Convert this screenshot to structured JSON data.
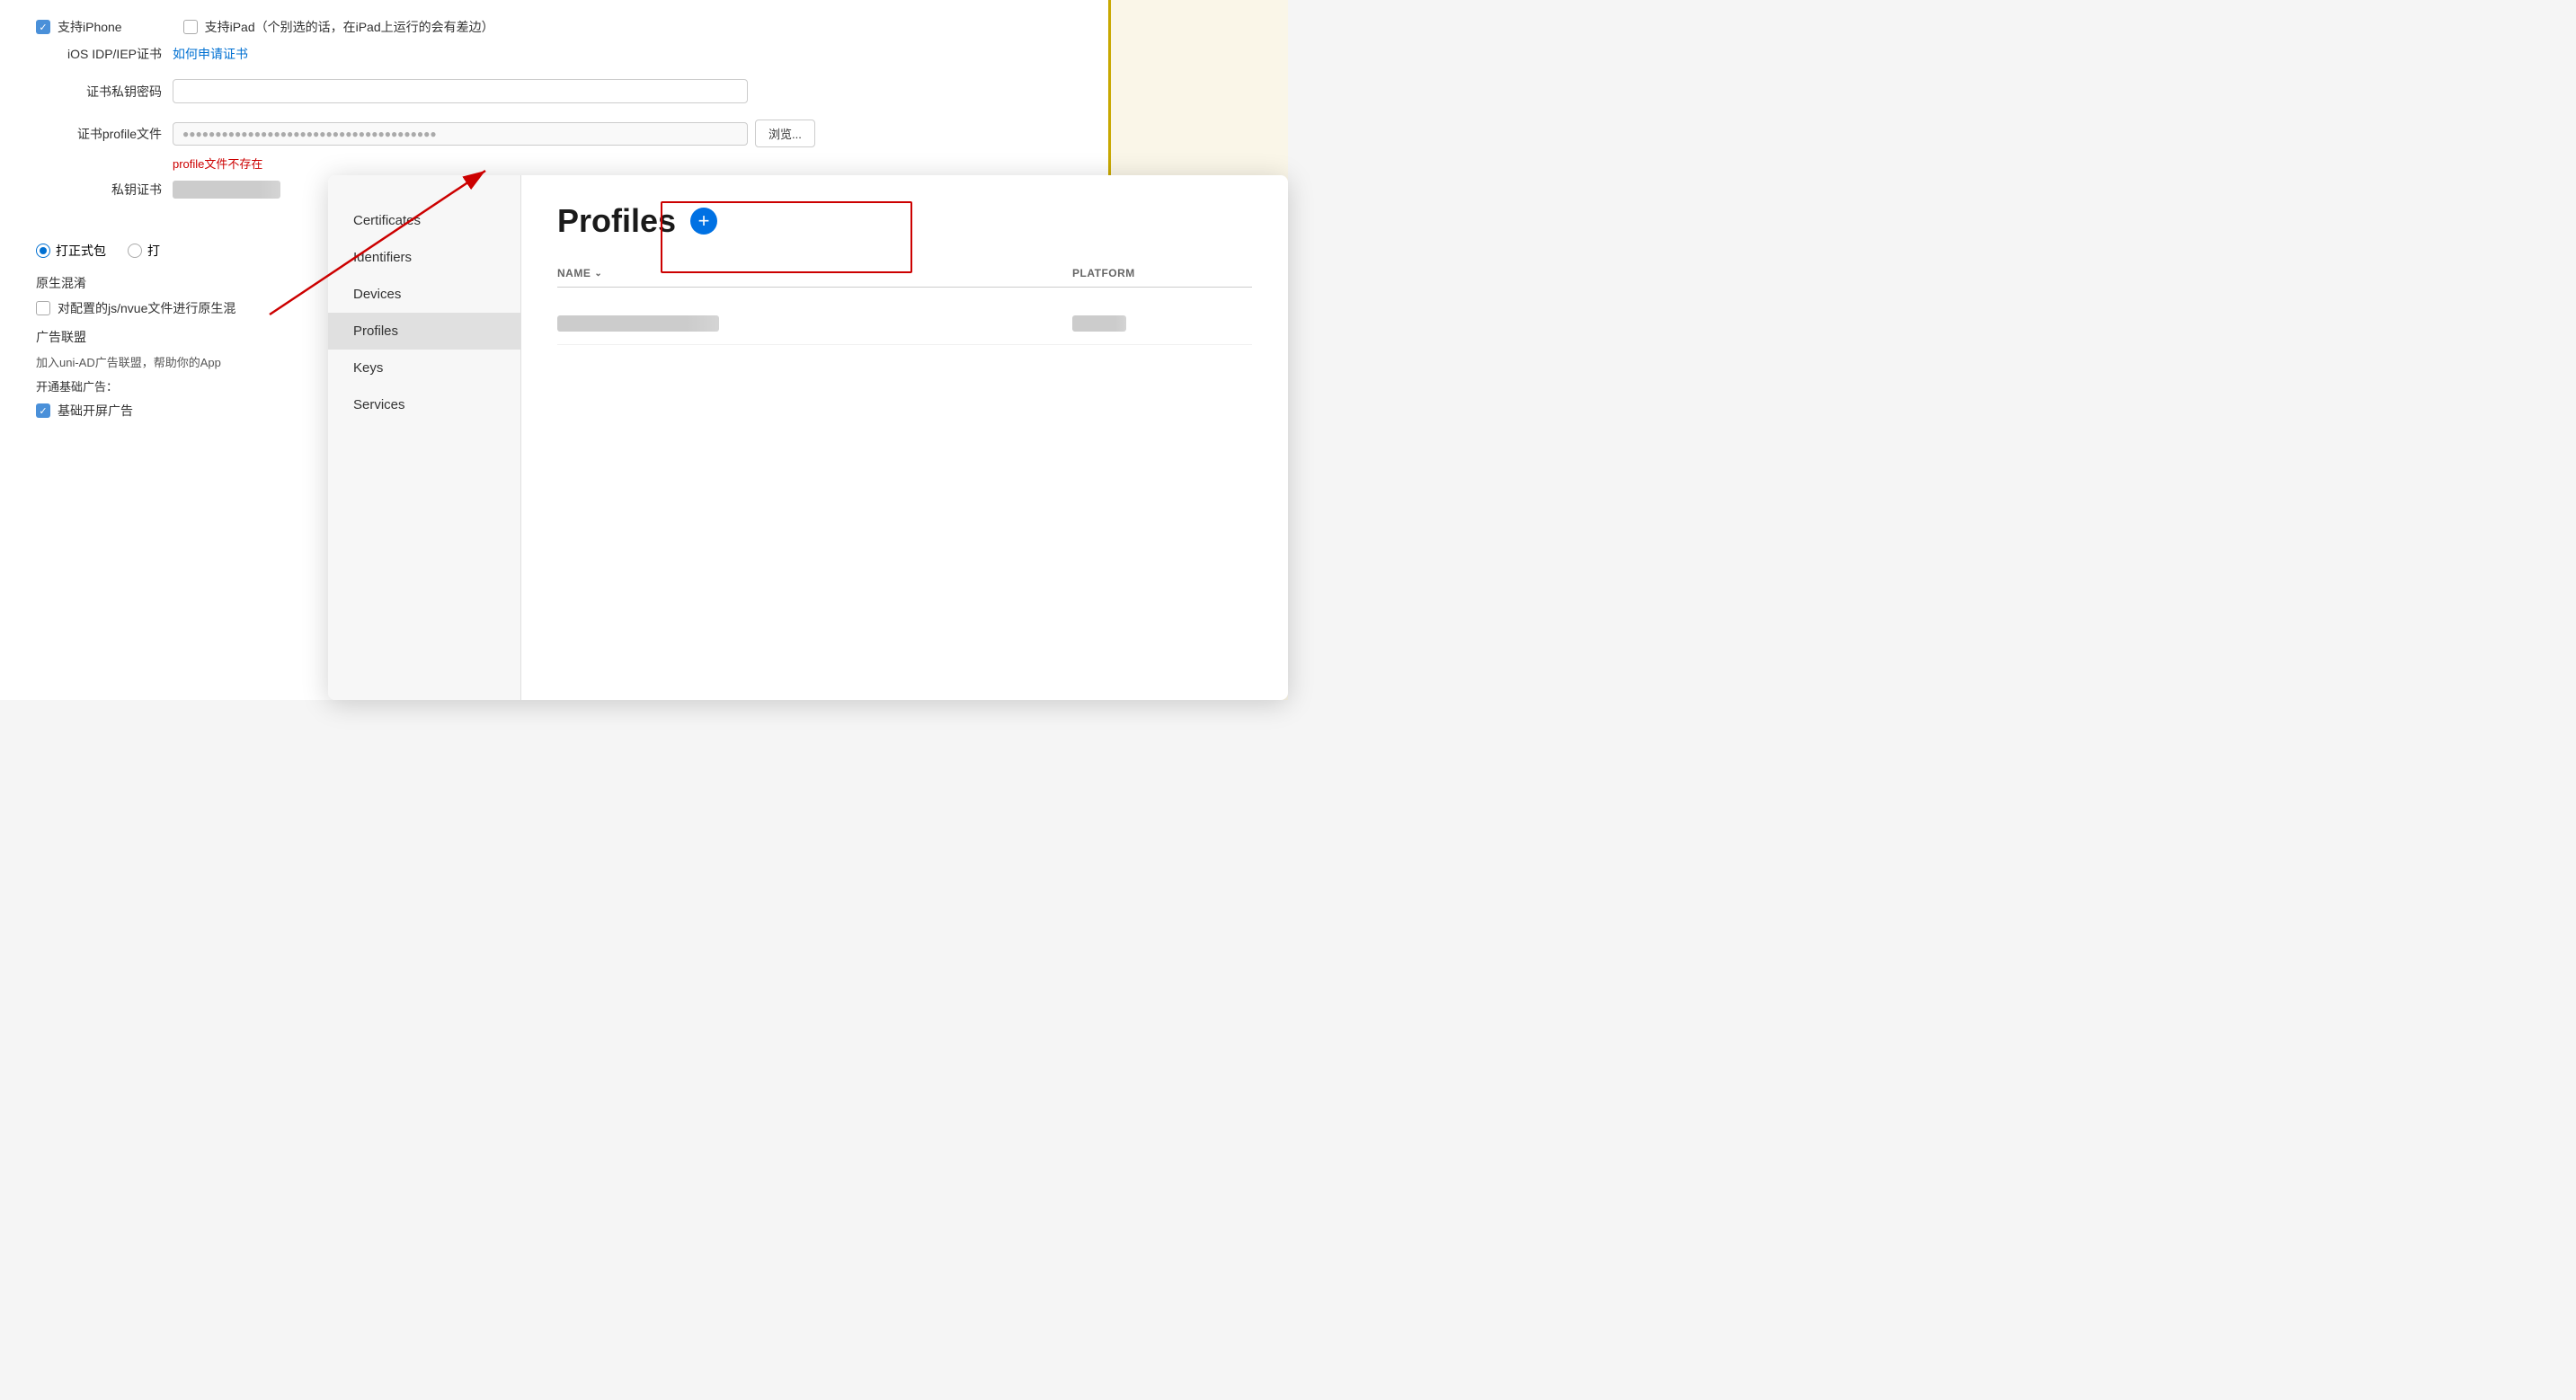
{
  "background": {
    "checkbox_iphone_label": "支持iPhone",
    "checkbox_ipad_label": "支持iPad（个别选的话，在iPad上运行的会有差边）",
    "cert_label": "iOS IDP/IEP证书",
    "cert_link": "如何申请证书",
    "password_label": "证书私钥密码",
    "profile_label": "证书profile文件",
    "profile_value": "●●●●●●●●●●●●●●●●●●●●●●●●●●●●●●●●●●●●",
    "browse_label": "浏览...",
    "error_text": "profile文件不存在",
    "private_cert_label": "私钥证书",
    "package_label": "打正式包",
    "package_label2": "打",
    "obfuscation_label": "原生混淆",
    "obfuscation_desc": "对配置的js/nvue文件进行原生混",
    "ad_label": "广告联盟",
    "ad_desc": "加入uni-AD广告联盟，帮助你的App",
    "ad_open": "开通基础广告：",
    "ad_checkbox": "基础开屏广告"
  },
  "apple_dev": {
    "nav_items": [
      {
        "id": "certificates",
        "label": "Certificates",
        "active": false
      },
      {
        "id": "identifiers",
        "label": "Identifiers",
        "active": false
      },
      {
        "id": "devices",
        "label": "Devices",
        "active": false
      },
      {
        "id": "profiles",
        "label": "Profiles",
        "active": true
      },
      {
        "id": "keys",
        "label": "Keys",
        "active": false
      },
      {
        "id": "services",
        "label": "Services",
        "active": false
      }
    ],
    "page_title": "Profiles",
    "add_button_label": "+",
    "table": {
      "col_name": "NAME",
      "col_platform": "PLATFORM",
      "rows": [
        {
          "name": "●●●●●●●●●●●●●",
          "platform": "●●●●"
        }
      ]
    }
  }
}
